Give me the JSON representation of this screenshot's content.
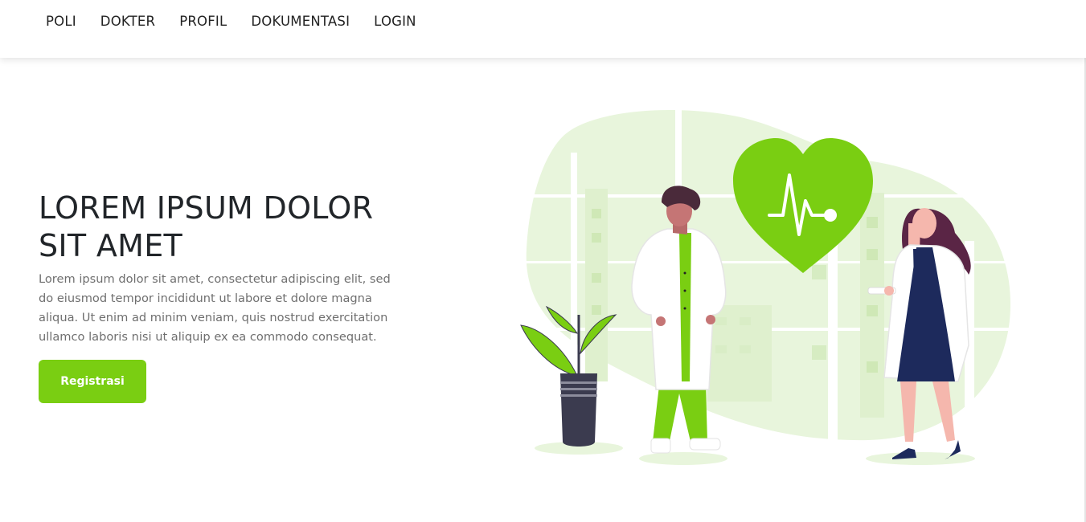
{
  "nav": {
    "items": [
      "POLI",
      "DOKTER",
      "PROFIL",
      "DOKUMENTASI",
      "LOGIN"
    ]
  },
  "hero": {
    "title_line1": "LOREM IPSUM DOLOR",
    "title_line2": "SIT AMET",
    "description": "Lorem ipsum dolor sit amet, consectetur adipiscing elit, sed do eiusmod tempor incididunt ut labore et dolore magna aliqua. Ut enim ad minim veniam, quis nostrud exercitation ullamco laboris nisi ut aliquip ex ea commodo consequat.",
    "button_label": "Registrasi"
  },
  "colors": {
    "accent": "#7ace12",
    "accent_light": "#e8f5dc",
    "navy": "#1d2a5c",
    "plum": "#5a2545"
  },
  "illustration": {
    "icons": [
      "heart-icon",
      "heartbeat-line-icon",
      "doctor-male",
      "doctor-female",
      "potted-plant",
      "city-buildings"
    ]
  }
}
